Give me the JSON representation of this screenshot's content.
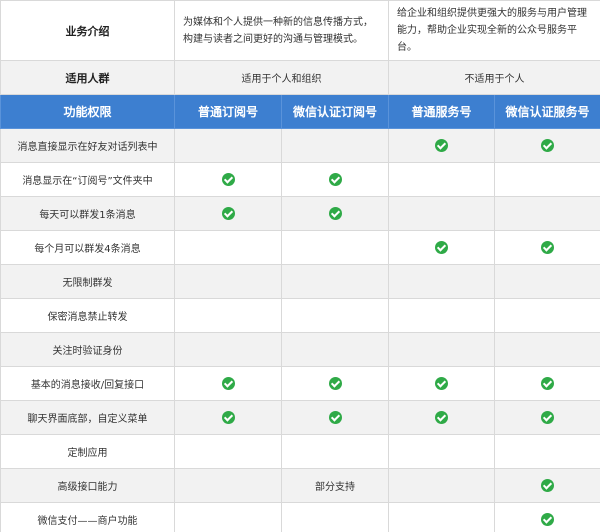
{
  "intro": {
    "label": "业务介绍",
    "subscription_desc": "为媒体和个人提供一种新的信息传播方式，构建与读者之间更好的沟通与管理模式。",
    "service_desc": "给企业和组织提供更强大的服务与用户管理能力，帮助企业实现全新的公众号服务平台。"
  },
  "audience": {
    "label": "适用人群",
    "subscription": "适用于个人和组织",
    "service": "不适用于个人"
  },
  "header": {
    "feature_col": "功能权限",
    "columns": [
      "普通订阅号",
      "微信认证订阅号",
      "普通服务号",
      "微信认证服务号"
    ]
  },
  "colors": {
    "header_bg": "#3d7fd0",
    "check": "#2faa47",
    "stripe": "#f2f2f2"
  },
  "icons": {
    "check": "check-circle-icon"
  },
  "features": [
    {
      "name": "消息直接显示在好友对话列表中",
      "cells": [
        "",
        "",
        "check",
        "check"
      ]
    },
    {
      "name": "消息显示在“订阅号”文件夹中",
      "cells": [
        "check",
        "check",
        "",
        ""
      ]
    },
    {
      "name": "每天可以群发1条消息",
      "cells": [
        "check",
        "check",
        "",
        ""
      ]
    },
    {
      "name": "每个月可以群发4条消息",
      "cells": [
        "",
        "",
        "check",
        "check"
      ]
    },
    {
      "name": "无限制群发",
      "cells": [
        "",
        "",
        "",
        ""
      ]
    },
    {
      "name": "保密消息禁止转发",
      "cells": [
        "",
        "",
        "",
        ""
      ]
    },
    {
      "name": "关注时验证身份",
      "cells": [
        "",
        "",
        "",
        ""
      ]
    },
    {
      "name": "基本的消息接收/回复接口",
      "cells": [
        "check",
        "check",
        "check",
        "check"
      ]
    },
    {
      "name": "聊天界面底部，自定义菜单",
      "cells": [
        "check",
        "check",
        "check",
        "check"
      ]
    },
    {
      "name": "定制应用",
      "cells": [
        "",
        "",
        "",
        ""
      ]
    },
    {
      "name": "高级接口能力",
      "cells": [
        "",
        "部分支持",
        "",
        "check"
      ]
    },
    {
      "name": "微信支付——商户功能",
      "cells": [
        "",
        "",
        "",
        "check"
      ]
    }
  ]
}
